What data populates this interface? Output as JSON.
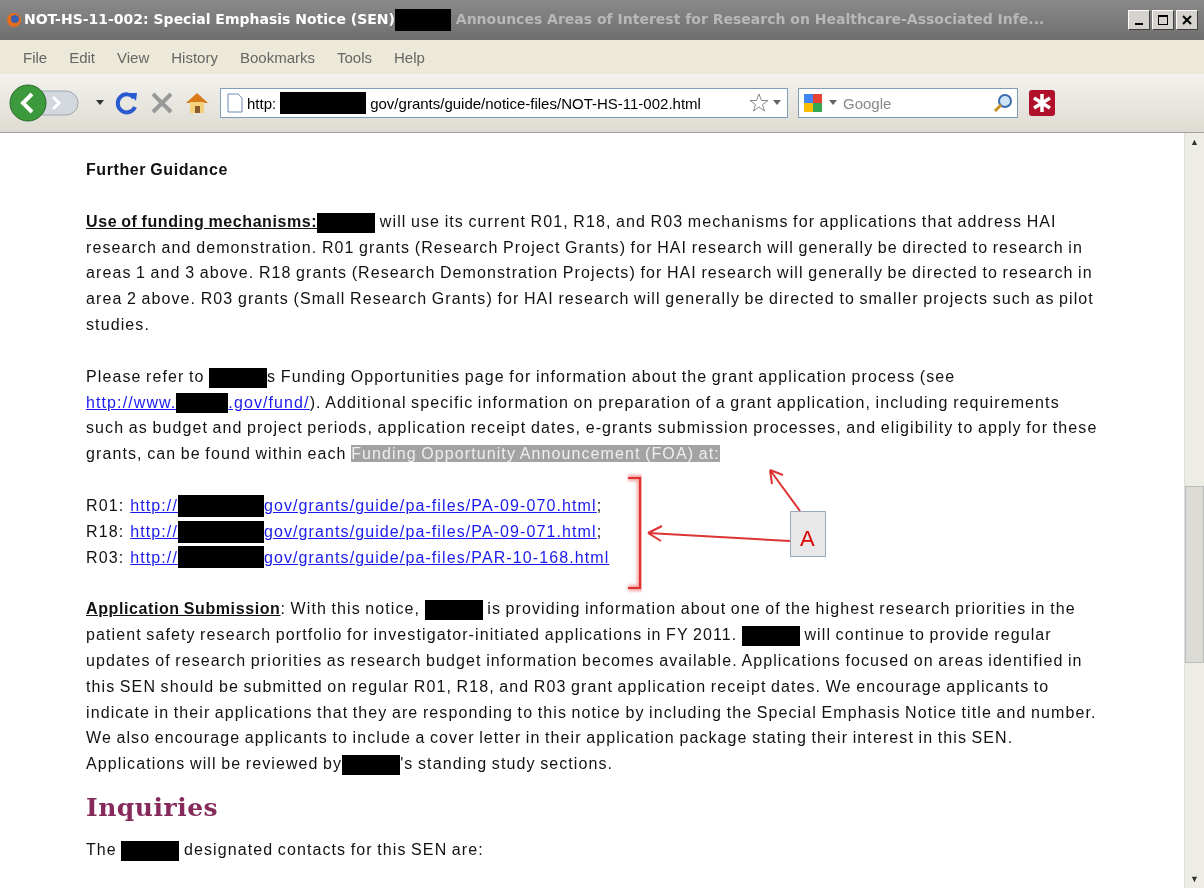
{
  "window": {
    "title": [
      {
        "kind": "text",
        "text": "NOT-HS-11-002: Special Emphasis Notice (SEN)"
      },
      {
        "kind": "redacted"
      },
      {
        "kind": "faded",
        "text": " Announces Areas of Interest for Research on Healthcare-Associated Infe..."
      }
    ]
  },
  "menu": [
    "File",
    "Edit",
    "View",
    "History",
    "Bookmarks",
    "Tools",
    "Help"
  ],
  "address": [
    {
      "kind": "text",
      "text": "http:"
    },
    {
      "kind": "redacted"
    },
    {
      "kind": "text",
      "text": "gov/grants/guide/notice-files/NOT-HS-11-002.html"
    }
  ],
  "search": {
    "placeholder": "Google"
  },
  "scrollbar": {
    "up": "▲",
    "down": "▼"
  },
  "content": {
    "heading": "Further Guidance",
    "paragraphs": [
      [
        {
          "kind": "label",
          "text": "Use of funding mechanisms:"
        },
        {
          "kind": "redacted"
        },
        {
          "kind": "text",
          "text": " will use its current R01, R18, and R03 mechanisms for applications that address HAI research and demonstration. R01 grants (Research Project Grants) for HAI research will generally be directed to research in areas 1 and 3 above. R18 grants (Research Demonstration Projects) for HAI research will generally be directed to research in area 2 above. R03 grants (Small Research Grants) for HAI research will generally be directed to smaller projects such as pilot studies."
        }
      ],
      [
        {
          "kind": "text",
          "text": "Please refer to "
        },
        {
          "kind": "redacted"
        },
        {
          "kind": "text",
          "text": "s Funding Opportunities page for information about the grant application process (see"
        },
        {
          "kind": "break"
        },
        {
          "kind": "link",
          "text": "http://www."
        },
        {
          "kind": "redacted-link"
        },
        {
          "kind": "link",
          "text": ".gov/fund/"
        },
        {
          "kind": "text",
          "text": ").  Additional specific information on preparation of a grant application, including requirements such as budget and project periods, application receipt dates, e-grants submission processes, and eligibility to apply for these grants, can be found within each "
        },
        {
          "kind": "highlight",
          "text": "Funding Opportunity Announcement (FOA) at:"
        }
      ]
    ],
    "links": [
      {
        "label": "R01:",
        "prefix": "http://",
        "path": "gov/grants/guide/pa-files/PA-09-070.html",
        "suffix": ";"
      },
      {
        "label": "R18:",
        "prefix": "http://",
        "path": "gov/grants/guide/pa-files/PA-09-071.html",
        "suffix": ";"
      },
      {
        "label": "R03:",
        "prefix": "http://",
        "path": "gov/grants/guide/pa-files/PAR-10-168.html"
      }
    ],
    "callout": {
      "label": "A"
    },
    "paragraphs_after": [
      [
        {
          "kind": "label",
          "text": "Application Submission"
        },
        {
          "kind": "text",
          "text": ":  With this notice, "
        },
        {
          "kind": "redacted"
        },
        {
          "kind": "text",
          "text": " is providing information about one of the highest research priorities in the patient safety research portfolio for investigator-initiated applications in FY 2011. "
        },
        {
          "kind": "redacted"
        },
        {
          "kind": "text",
          "text": " will continue to provide regular updates of research priorities as research budget information becomes available. Applications focused on areas identified in this SEN should be submitted on regular R01, R18, and R03 grant application receipt dates. We encourage applicants to indicate in their applications that they are responding to this notice by including the Special Emphasis Notice title and number. We also encourage applicants to include a cover letter in their application package stating their interest in this SEN. Applications will be reviewed by"
        },
        {
          "kind": "redacted"
        },
        {
          "kind": "text",
          "text": "'s standing study sections."
        }
      ]
    ],
    "section_heading": "Inquiries",
    "closing": [
      {
        "kind": "text",
        "text": "The "
      },
      {
        "kind": "redacted"
      },
      {
        "kind": "text",
        "text": " designated contacts for this SEN are:"
      }
    ]
  }
}
